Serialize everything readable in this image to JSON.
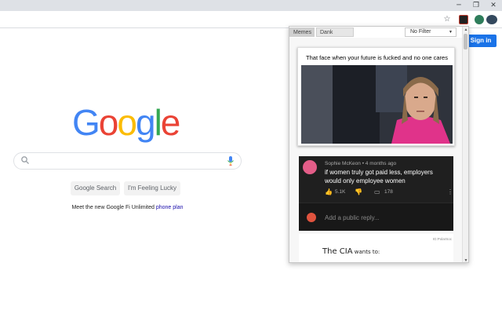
{
  "browser": {
    "window_controls": [
      "─",
      "❐",
      "✕"
    ]
  },
  "google": {
    "logo_letters": [
      {
        "ch": "G",
        "color": "#4285f4"
      },
      {
        "ch": "o",
        "color": "#ea4335"
      },
      {
        "ch": "o",
        "color": "#fbbc05"
      },
      {
        "ch": "g",
        "color": "#4285f4"
      },
      {
        "ch": "l",
        "color": "#34a853"
      },
      {
        "ch": "e",
        "color": "#ea4335"
      }
    ],
    "search_button": "Google Search",
    "lucky_button": "I'm Feeling Lucky",
    "promo_text": "Meet the new Google Fi Unlimited ",
    "promo_link": "phone plan",
    "signin_label": "Sign in"
  },
  "popup": {
    "tabs": [
      "Memes",
      "Dank memes"
    ],
    "active_tab": 0,
    "filter_value": "No Filter",
    "meme1": {
      "caption": "That face when your future is fucked and no one cares"
    },
    "meme2": {
      "author": "Sophie McKeon • 4 months ago",
      "comment": "if women truly got paid less, employers would only employee women",
      "likes": "5.1K",
      "replies": "178",
      "reply_placeholder": "Add a public reply..."
    },
    "meme3": {
      "credit": "IG:PolarSoc",
      "text_big": "The CIA",
      "text_small": " wants to:"
    }
  },
  "colors": {
    "accent": "#1a73e8",
    "popup_border": "#c8c8c8",
    "dark_comment_bg": "#1f1f1f"
  }
}
